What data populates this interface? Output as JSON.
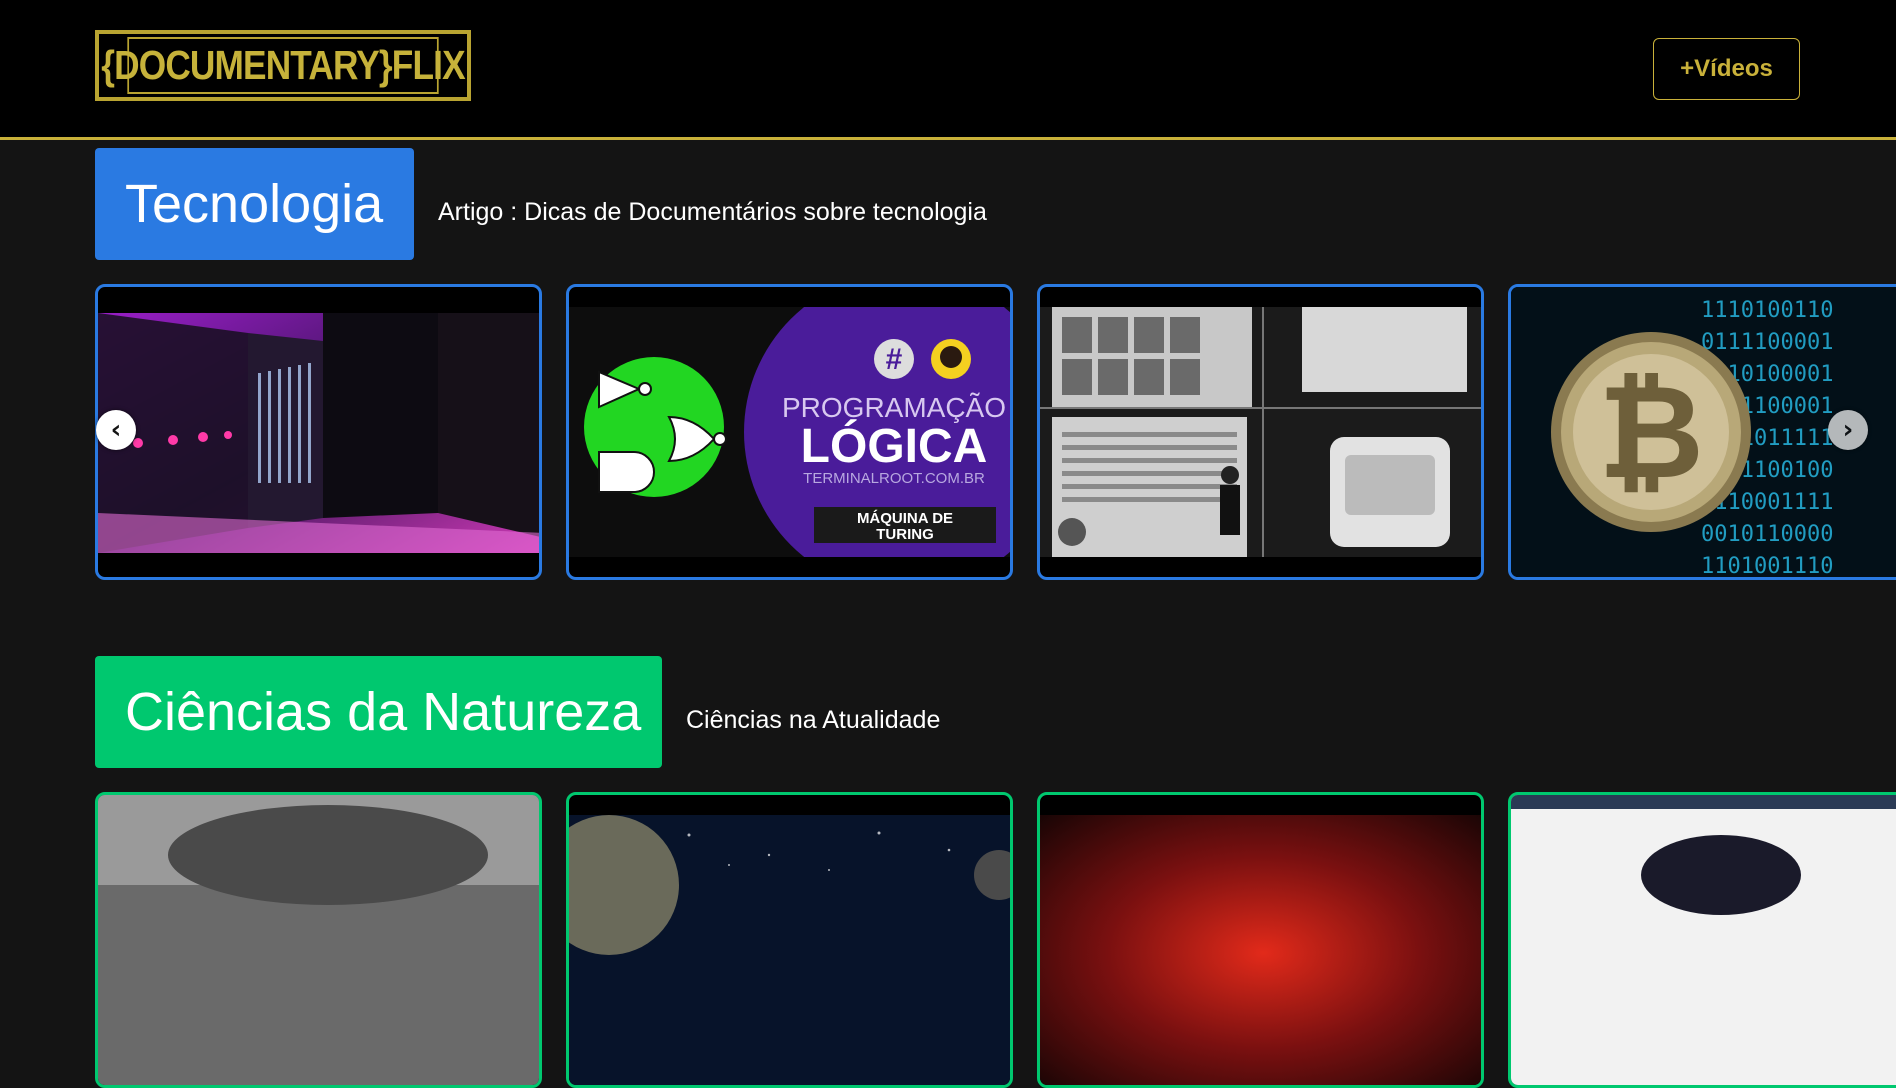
{
  "header": {
    "logo_text": "{DOCUMENTARY}FLIX",
    "more_videos_label": "+Vídeos",
    "accent_color": "#c9b13a"
  },
  "sections": [
    {
      "title": "Tecnologia",
      "subtitle": "Artigo : Dicas de Documentários sobre tecnologia",
      "color": "#2a7ae2",
      "cards": [
        {
          "thumbnail": "supercomputer-datacenter"
        },
        {
          "thumbnail": "programacao-logica-maquina-de-turing",
          "lines": [
            "PROGRAMAÇÃO",
            "LÓGICA",
            "TERMINALROOT.COM.BR",
            "MÁQUINA DE",
            "TURING"
          ]
        },
        {
          "thumbnail": "keynote-presentation-screens"
        },
        {
          "thumbnail": "bitcoin-binary"
        }
      ],
      "prev_arrow": "chevron-left-icon",
      "next_arrow": "chevron-right-icon"
    },
    {
      "title": "Ciências da Natureza",
      "subtitle": "Ciências na Atualidade",
      "color": "#00c86f",
      "cards": [
        {
          "thumbnail": "nature-documentary-1"
        },
        {
          "thumbnail": "space-documentary"
        },
        {
          "thumbnail": "red-nebula-documentary"
        },
        {
          "thumbnail": "animal-documentary"
        }
      ]
    }
  ]
}
